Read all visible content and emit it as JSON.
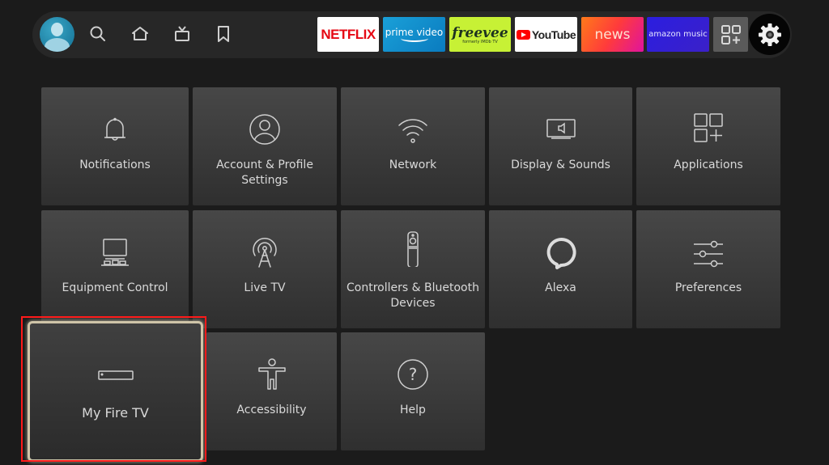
{
  "top_nav": {
    "profile_label": "Profile",
    "icons": [
      "search-icon",
      "home-icon",
      "live-tv-icon",
      "bookmark-icon"
    ],
    "apps": [
      {
        "name": "Netflix",
        "label": "NETFLIX"
      },
      {
        "name": "Prime Video",
        "label": "prime video"
      },
      {
        "name": "Freevee",
        "label": "freevee",
        "sublabel": "formerly IMDb TV"
      },
      {
        "name": "YouTube",
        "label": "YouTube"
      },
      {
        "name": "News",
        "label": "news"
      },
      {
        "name": "Amazon Music",
        "label": "amazon music"
      },
      {
        "name": "App Library",
        "icon": "apps-grid-plus-icon"
      }
    ],
    "settings_icon": "gear-icon"
  },
  "settings_tiles": [
    {
      "label": "Notifications",
      "icon": "bell-icon"
    },
    {
      "label": "Account & Profile Settings",
      "icon": "user-circle-icon"
    },
    {
      "label": "Network",
      "icon": "wifi-icon"
    },
    {
      "label": "Display & Sounds",
      "icon": "display-sound-icon"
    },
    {
      "label": "Applications",
      "icon": "apps-icon"
    },
    {
      "label": "Equipment Control",
      "icon": "equipment-icon"
    },
    {
      "label": "Live TV",
      "icon": "antenna-icon"
    },
    {
      "label": "Controllers & Bluetooth Devices",
      "icon": "remote-icon"
    },
    {
      "label": "Alexa",
      "icon": "alexa-icon"
    },
    {
      "label": "Preferences",
      "icon": "sliders-icon"
    },
    {
      "label": "My Fire TV",
      "icon": "fire-tv-stick-icon",
      "focused": true
    },
    {
      "label": "Accessibility",
      "icon": "accessibility-icon"
    },
    {
      "label": "Help",
      "icon": "help-icon"
    }
  ],
  "colors": {
    "highlight_box": "#ff1a1a",
    "focus_border": "#cfc4a8"
  }
}
